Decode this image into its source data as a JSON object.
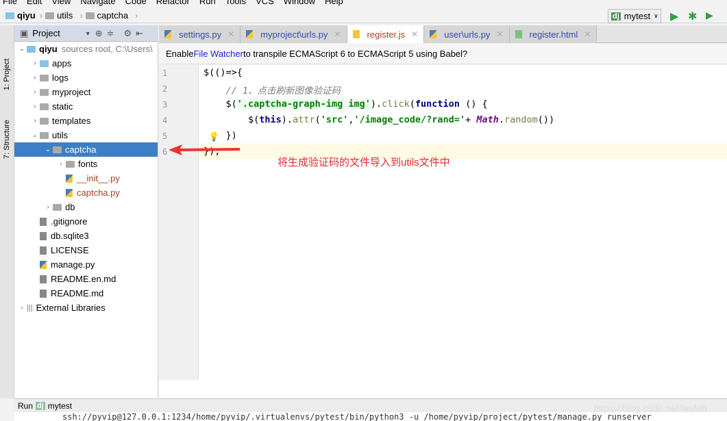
{
  "menu": [
    "File",
    "Edit",
    "View",
    "Navigate",
    "Code",
    "Refactor",
    "Run",
    "Tools",
    "VCS",
    "Window",
    "Help"
  ],
  "breadcrumb": [
    "qiyu",
    "utils",
    "captcha"
  ],
  "run_config": {
    "label": "mytest"
  },
  "side_tabs": {
    "project": "1: Project",
    "structure": "7: Structure"
  },
  "project_panel": {
    "title": "Project"
  },
  "tree": [
    {
      "label": "qiyu",
      "hint": "sources root, C:\\Users\\",
      "depth": 0,
      "type": "folder-blue",
      "expanded": true
    },
    {
      "label": "apps",
      "depth": 1,
      "type": "folder-blue"
    },
    {
      "label": "logs",
      "depth": 1,
      "type": "folder"
    },
    {
      "label": "myproject",
      "depth": 1,
      "type": "folder"
    },
    {
      "label": "static",
      "depth": 1,
      "type": "folder"
    },
    {
      "label": "templates",
      "depth": 1,
      "type": "folder"
    },
    {
      "label": "utils",
      "depth": 1,
      "type": "folder",
      "expanded": true
    },
    {
      "label": "captcha",
      "depth": 2,
      "type": "folder",
      "expanded": true,
      "selected": true
    },
    {
      "label": "fonts",
      "depth": 3,
      "type": "folder"
    },
    {
      "label": "__init__.py",
      "depth": 3,
      "type": "py"
    },
    {
      "label": "captcha.py",
      "depth": 3,
      "type": "py"
    },
    {
      "label": "db",
      "depth": 2,
      "type": "folder"
    },
    {
      "label": ".gitignore",
      "depth": 1,
      "type": "file"
    },
    {
      "label": "db.sqlite3",
      "depth": 1,
      "type": "file"
    },
    {
      "label": "LICENSE",
      "depth": 1,
      "type": "file"
    },
    {
      "label": "manage.py",
      "depth": 1,
      "type": "py"
    },
    {
      "label": "README.en.md",
      "depth": 1,
      "type": "file"
    },
    {
      "label": "README.md",
      "depth": 1,
      "type": "file"
    },
    {
      "label": "External Libraries",
      "depth": 0,
      "type": "lib"
    }
  ],
  "tabs": [
    {
      "label": "settings.py",
      "icon": "python-icon"
    },
    {
      "label": "myproject\\urls.py",
      "icon": "python-icon"
    },
    {
      "label": "register.js",
      "icon": "js-icon",
      "active": true
    },
    {
      "label": "user\\urls.py",
      "icon": "python-icon"
    },
    {
      "label": "register.html",
      "icon": "html-icon"
    }
  ],
  "banner": {
    "pre": "Enable ",
    "link": "File Watcher",
    "post": " to transpile ECMAScript 6 to ECMAScript 5 using Babel?"
  },
  "code": {
    "lines": [
      "1",
      "2",
      "3",
      "4",
      "5",
      "6"
    ],
    "l1": "$(()=>{",
    "l2": "    // 1、点击刷新图像验证码",
    "l3a": "    $(",
    "l3b": "'.captcha-graph-img img'",
    "l3c": ").",
    "l3d": "click",
    "l3e": "(",
    "l3f": "function",
    "l3g": " () {",
    "l4a": "        $(",
    "l4b": "this",
    "l4c": ").",
    "l4d": "attr",
    "l4e": "(",
    "l4f": "'src'",
    "l4g": ",",
    "l4h": "'/image_code/?rand='",
    "l4i": "+ ",
    "l4j": "Math",
    "l4k": ".",
    "l4l": "random",
    "l4m": "())",
    "l5": "    })",
    "l6": "});"
  },
  "annotation": "将生成验证码的文件导入到utils文件中",
  "run_bar": {
    "label": "Run",
    "config": "mytest"
  },
  "console": "ssh://pyvip@127.0.0.1:1234/home/pyvip/.virtualenvs/pytest/bin/python3 -u /home/pyvip/project/pytest/manage.py runserver",
  "watermark": "https://blog.csdn.net/lksfdh"
}
